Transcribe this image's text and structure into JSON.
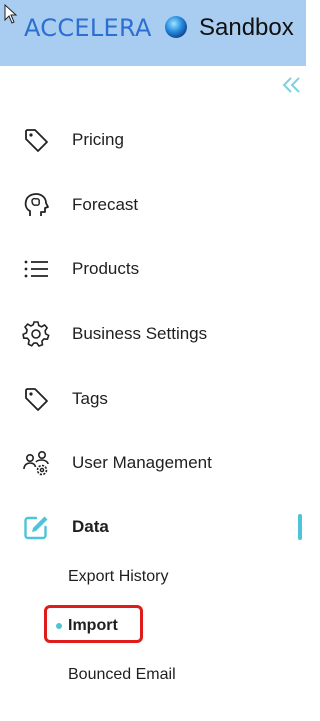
{
  "header": {
    "logo_text": "ACCELERA",
    "environment": "Sandbox",
    "background": "#a9cdf0"
  },
  "sidebar": {
    "collapse_icon": "double-chevron-left-icon",
    "accent_color": "#4fc3d9",
    "items": [
      {
        "label": "Pricing",
        "icon": "tag-icon"
      },
      {
        "label": "Forecast",
        "icon": "head-brain-icon"
      },
      {
        "label": "Products",
        "icon": "list-icon"
      },
      {
        "label": "Business Settings",
        "icon": "gear-icon"
      },
      {
        "label": "Tags",
        "icon": "tag-icon"
      },
      {
        "label": "User Management",
        "icon": "users-gear-icon"
      },
      {
        "label": "Data",
        "icon": "edit-icon",
        "active": true
      }
    ],
    "sub_items": [
      {
        "label": "Export History"
      },
      {
        "label": "Import",
        "active": true
      },
      {
        "label": "Bounced Email"
      }
    ]
  },
  "highlight_color": "#e01b1b"
}
